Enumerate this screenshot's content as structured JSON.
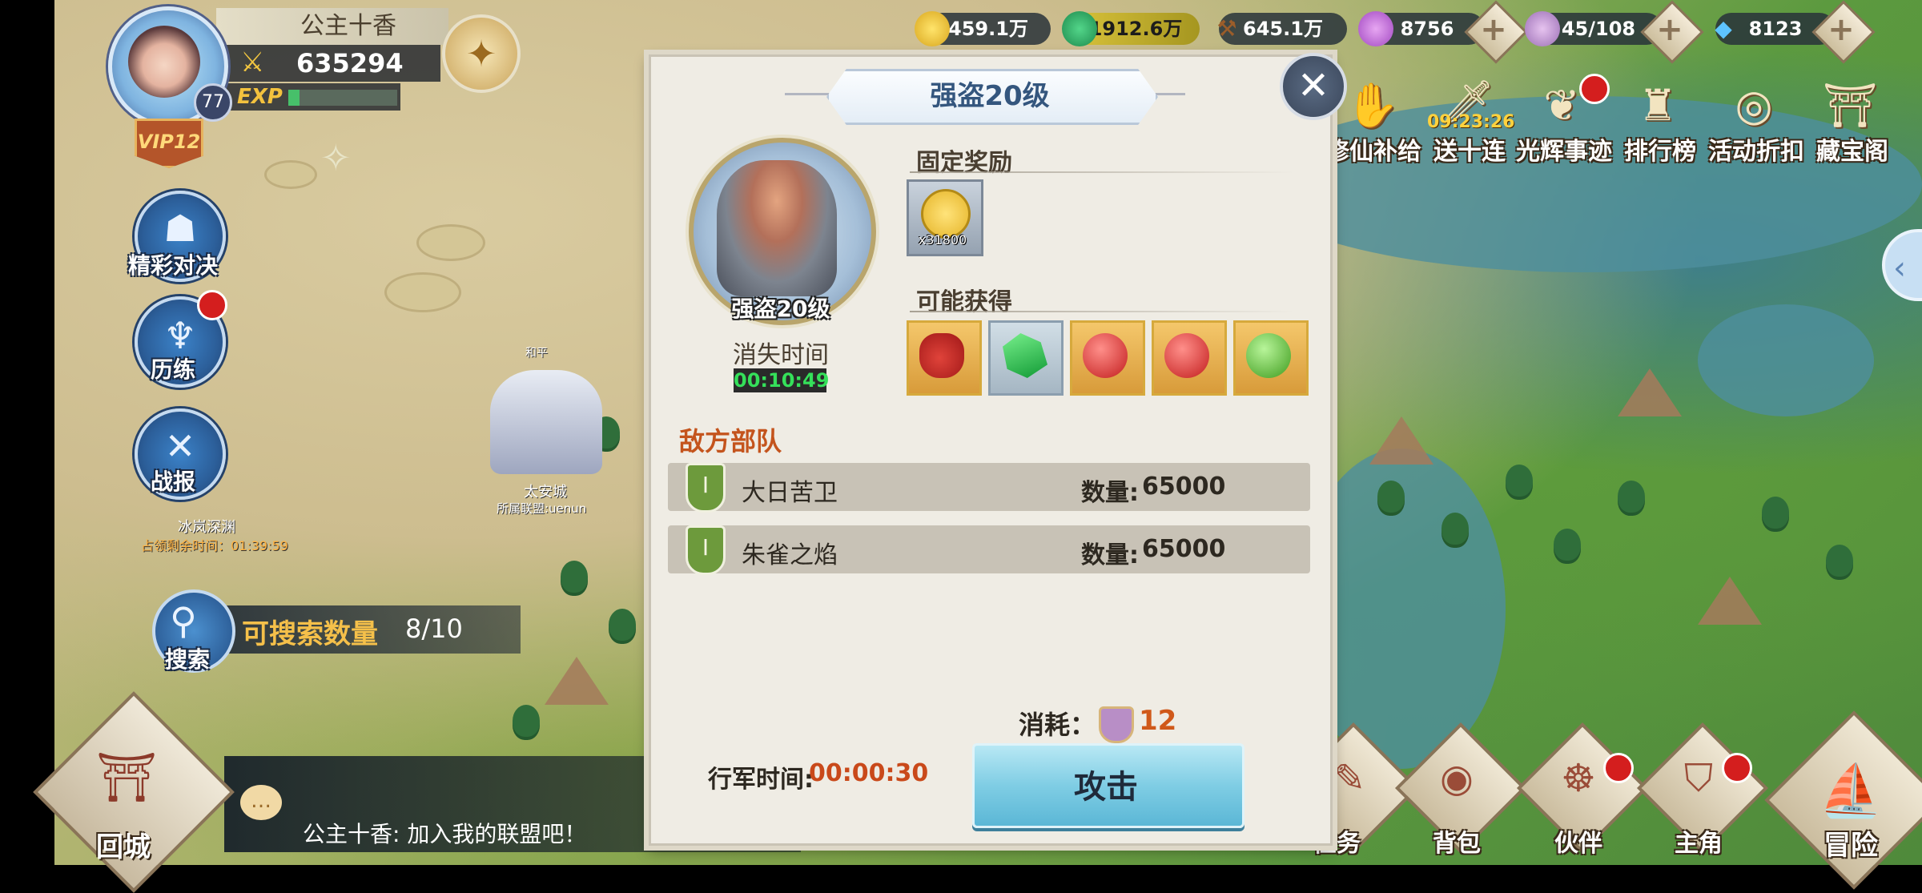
{
  "player": {
    "name": "公主十香",
    "power": "635294",
    "level": "77",
    "vip": "VIP12",
    "exp_label": "EXP",
    "exp_fraction": 0.1
  },
  "resources": [
    {
      "icon": "gold-coin-icon",
      "value": "459.1万"
    },
    {
      "icon": "green-gem-icon",
      "value": "1912.6万"
    },
    {
      "icon": "wood-icon",
      "value": "645.1万"
    },
    {
      "icon": "purple-orb-icon",
      "value": "8756"
    },
    {
      "icon": "shield-stamina-icon",
      "value": "45/108"
    },
    {
      "icon": "diamond-icon",
      "value": "8123"
    }
  ],
  "top_menu": [
    {
      "label": "修仙补给",
      "icon": "hand-icon"
    },
    {
      "label": "送十连",
      "icon": "sword-icon",
      "countdown": "09:23:26"
    },
    {
      "label": "光辉事迹",
      "icon": "wings-icon"
    },
    {
      "label": "排行榜",
      "icon": "ranking-icon"
    },
    {
      "label": "活动折扣",
      "icon": "coin-icon"
    },
    {
      "label": "藏宝阁",
      "icon": "pavilion-icon"
    }
  ],
  "side_menu": [
    {
      "label": "精彩对决"
    },
    {
      "label": "历练"
    },
    {
      "label": "战报"
    }
  ],
  "map": {
    "city1_name": "冰岚深渊",
    "city1_time": "占领剩余时间：01:39:59",
    "city2_tag": "和平",
    "city2_name": "太安城",
    "city2_alliance": "所属联盟:uenun"
  },
  "search": {
    "button_label": "搜索",
    "label": "可搜索数量",
    "count": "8/10"
  },
  "chat": {
    "message": "公主十香: 加入我的联盟吧！"
  },
  "home_label": "回城",
  "bottom_menu": [
    {
      "label": "任务"
    },
    {
      "label": "背包"
    },
    {
      "label": "伙伴"
    },
    {
      "label": "主角"
    }
  ],
  "adventure_label": "冒险",
  "dialog": {
    "title": "强盗20级",
    "boss_name": "强盗20级",
    "vanish_label": "消失时间",
    "vanish_time": "00:10:49",
    "fixed_reward_title": "固定奖励",
    "fixed_reward_qty": "x31800",
    "possible_title": "可能获得",
    "possible_items": [
      "red-bag-icon",
      "green-crystal-icon",
      "red-orb-icon",
      "red-orb-icon",
      "green-orb-icon"
    ],
    "enemy_title": "敌方部队",
    "enemies": [
      {
        "name": "大日苦卫",
        "qty_label": "数量:",
        "qty": "65000"
      },
      {
        "name": "朱雀之焰",
        "qty_label": "数量:",
        "qty": "65000"
      }
    ],
    "cost_label": "消耗：",
    "cost_value": "12",
    "march_label": "行军时间:",
    "march_time": "00:00:30",
    "attack_label": "攻击"
  },
  "colors": {
    "dialog_bg": "#efece4",
    "enemy_title": "#c4541d",
    "march_time": "#c9491a",
    "attack_button": "#7fcde4",
    "vanish_time": "#35e05a"
  }
}
